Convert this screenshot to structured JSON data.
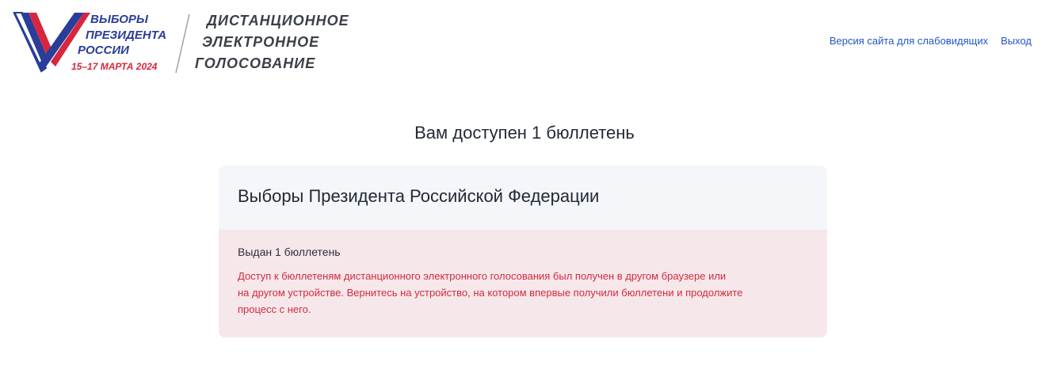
{
  "header": {
    "logo": {
      "line1": "ВЫБОРЫ",
      "line2": "ПРЕЗИДЕНТА",
      "line3": "РОССИИ",
      "dates": "15–17 МАРТА 2024",
      "title_lines": [
        "ДИСТАНЦИОННОЕ",
        "ЭЛЕКТРОННОЕ",
        "ГОЛОСОВАНИЕ"
      ]
    },
    "accessibility_link": "Версия сайта для слабовидящих",
    "logout_link": "Выход"
  },
  "main": {
    "heading": "Вам доступен 1 бюллетень",
    "card": {
      "title": "Выборы Президента Российской Федерации",
      "status": "Выдан 1 бюллетень",
      "warning_lines": [
        "Доступ к бюллетеням дистанционного электронного голосования был получен в другом браузере или",
        "на другом устройстве. Вернитесь на устройство, на котором впервые получили бюллетени и продолжите",
        "процесс с него."
      ]
    }
  },
  "colors": {
    "link": "#2256c5",
    "warning_text": "#d32b3f",
    "card_head_bg": "#f4f6f9",
    "card_body_bg": "#f6e7ea",
    "brand_blue": "#2a3d9a",
    "brand_red": "#d7263d"
  }
}
